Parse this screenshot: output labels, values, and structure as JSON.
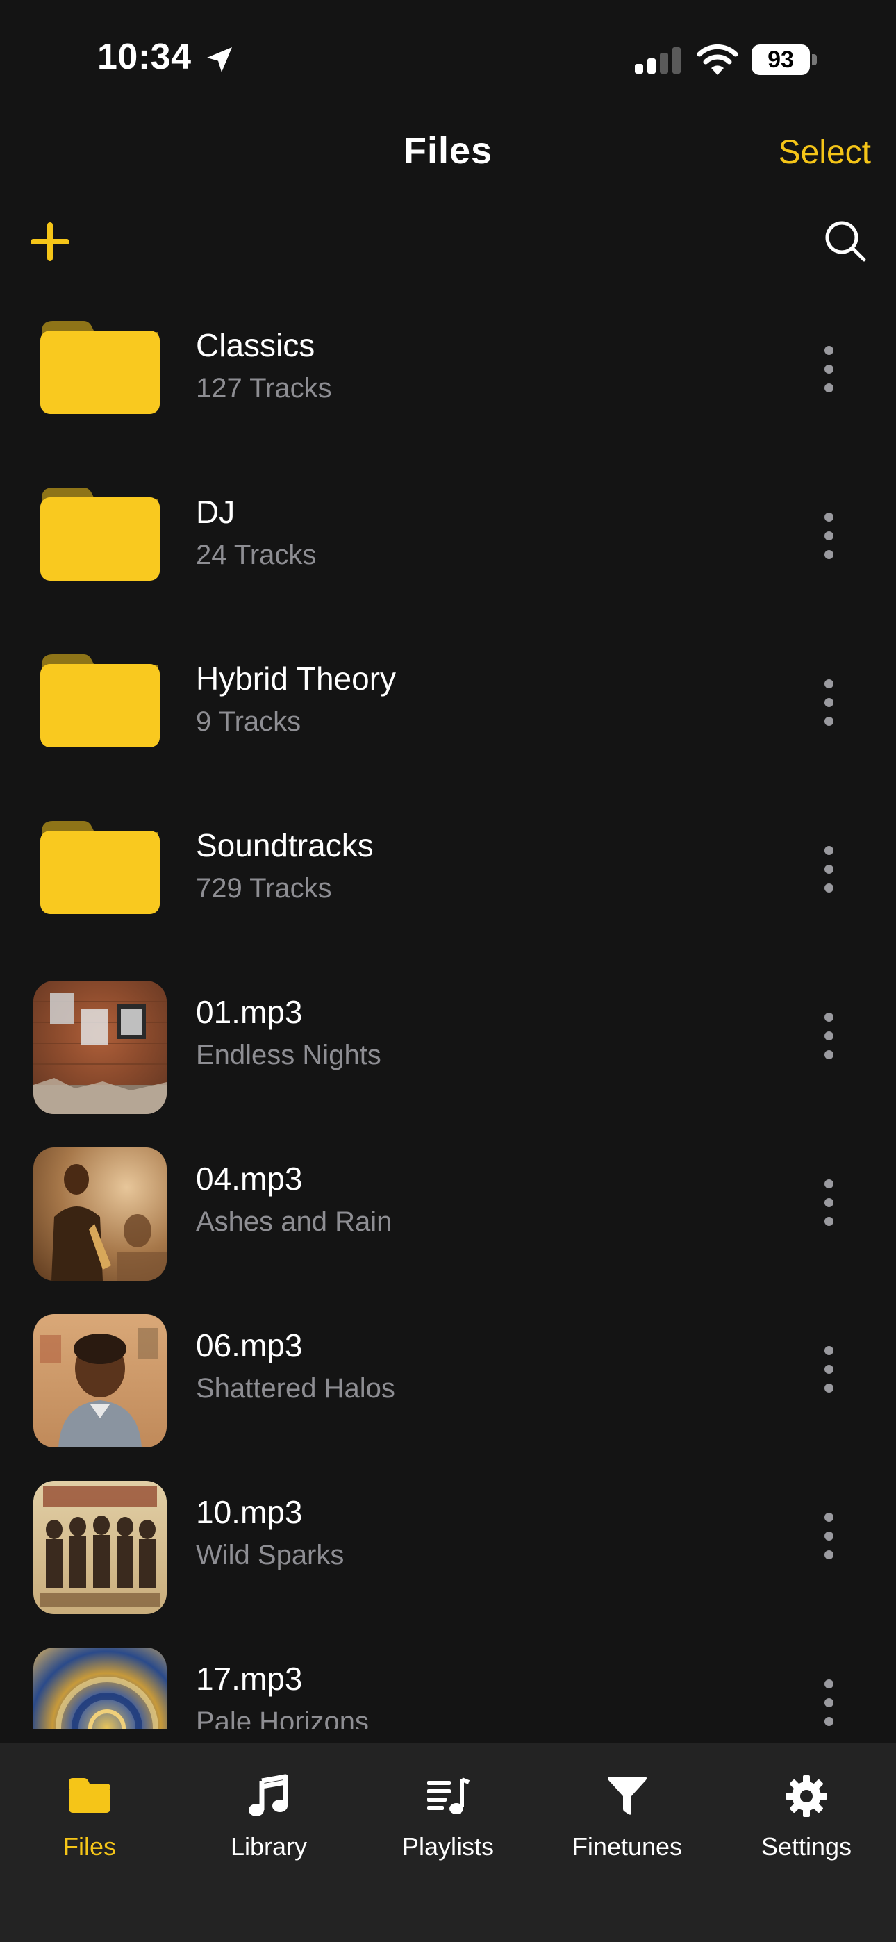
{
  "status_bar": {
    "time": "10:34",
    "battery": "93"
  },
  "header": {
    "title": "Files",
    "select_label": "Select"
  },
  "colors": {
    "accent": "#F5C518",
    "background": "#141414",
    "tab_bar": "#232323",
    "secondary_text": "#8e8e93"
  },
  "items": [
    {
      "kind": "folder",
      "icon": "folder-icon",
      "title": "Classics",
      "subtitle": "127 Tracks"
    },
    {
      "kind": "folder",
      "icon": "folder-icon",
      "title": "DJ",
      "subtitle": "24 Tracks"
    },
    {
      "kind": "folder",
      "icon": "folder-icon",
      "title": "Hybrid Theory",
      "subtitle": "9 Tracks"
    },
    {
      "kind": "folder",
      "icon": "folder-icon",
      "title": "Soundtracks",
      "subtitle": "729 Tracks"
    },
    {
      "kind": "file",
      "icon": "album-art",
      "title": "01.mp3",
      "subtitle": "Endless Nights"
    },
    {
      "kind": "file",
      "icon": "album-art",
      "title": "04.mp3",
      "subtitle": "Ashes and Rain"
    },
    {
      "kind": "file",
      "icon": "album-art",
      "title": "06.mp3",
      "subtitle": "Shattered Halos"
    },
    {
      "kind": "file",
      "icon": "album-art",
      "title": "10.mp3",
      "subtitle": "Wild Sparks"
    },
    {
      "kind": "file",
      "icon": "album-art",
      "title": "17.mp3",
      "subtitle": "Pale Horizons"
    }
  ],
  "tabs": [
    {
      "label": "Files",
      "icon": "folder-icon",
      "active": true
    },
    {
      "label": "Library",
      "icon": "music-note-icon",
      "active": false
    },
    {
      "label": "Playlists",
      "icon": "playlist-icon",
      "active": false
    },
    {
      "label": "Finetunes",
      "icon": "funnel-icon",
      "active": false
    },
    {
      "label": "Settings",
      "icon": "gear-icon",
      "active": false
    }
  ]
}
